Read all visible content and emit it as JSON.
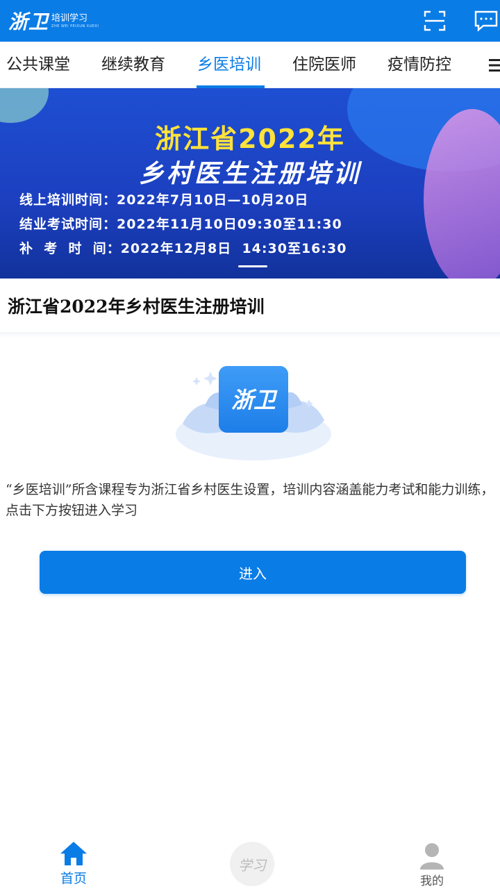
{
  "header": {
    "logo_mark": "浙卫",
    "logo_subtitle": "培训学习",
    "logo_tagline": "ZHE WEI PEIXUN XUEXI",
    "icons": [
      "scan-icon",
      "message-icon"
    ]
  },
  "tabs": [
    {
      "label": "公共课堂",
      "active": false
    },
    {
      "label": "继续教育",
      "active": false
    },
    {
      "label": "乡医培训",
      "active": true
    },
    {
      "label": "住院医师",
      "active": false
    },
    {
      "label": "疫情防控",
      "active": false
    }
  ],
  "banner": {
    "title_line1": "浙江省2022年",
    "title_line2": "乡村医生注册培训",
    "info_lines": [
      "线上培训时间：2022年7月10日—10月20日",
      "结业考试时间：2022年11月10日09:30至11:30",
      "补  考  时  间：2022年12月8日  14:30至16:30"
    ]
  },
  "course": {
    "title": "浙江省2022年乡村医生注册培训",
    "illustration_label": "浙卫",
    "description": "“乡医培训”所含课程专为浙江省乡村医生设置，培训内容涵盖能力考试和能力训练，点击下方按钮进入学习",
    "enter_button": "进入"
  },
  "bottom_nav": {
    "items": [
      {
        "label": "首页",
        "icon": "home-icon",
        "active": true
      },
      {
        "label": "学习",
        "icon": "study-icon",
        "active": false
      },
      {
        "label": "我的",
        "icon": "person-icon",
        "active": false
      }
    ]
  },
  "colors": {
    "primary": "#0a7ce6",
    "banner_title": "#ffe23a"
  }
}
